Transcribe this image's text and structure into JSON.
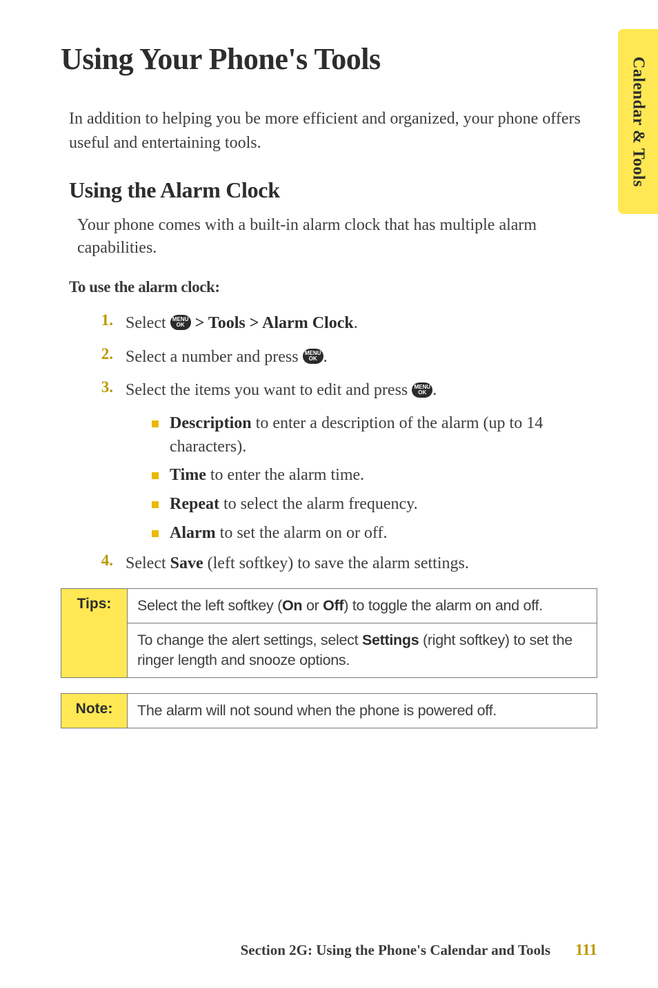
{
  "sideTab": {
    "label": "Calendar & Tools"
  },
  "h1": "Using Your Phone's Tools",
  "intro": "In addition to helping you be more efficient and organized, your phone offers useful and entertaining tools.",
  "h2": "Using the Alarm Clock",
  "body1": "Your phone comes with a built-in alarm clock that has multiple alarm capabilities.",
  "subhead": "To use the alarm clock:",
  "icon": {
    "label": "MENU\nOK"
  },
  "steps": {
    "s1": {
      "num": "1.",
      "pre": "Select ",
      "post": " > Tools > Alarm Clock",
      "tail": "."
    },
    "s2": {
      "num": "2.",
      "pre": "Select a number and press ",
      "tail": "."
    },
    "s3": {
      "num": "3.",
      "pre": "Select the items you want to edit and press ",
      "tail": "."
    },
    "s4": {
      "num": "4.",
      "pre": "Select ",
      "bold": "Save",
      "post": " (left softkey) to save the alarm settings."
    }
  },
  "bullets": {
    "b1": {
      "bold": "Description",
      "rest": " to enter a description of the alarm (up to 14 characters)."
    },
    "b2": {
      "bold": "Time",
      "rest": " to enter the alarm time."
    },
    "b3": {
      "bold": "Repeat",
      "rest": " to select the alarm frequency."
    },
    "b4": {
      "bold": "Alarm",
      "rest": " to set the alarm on or off."
    }
  },
  "tips": {
    "label": "Tips:",
    "row1": {
      "pre": "Select the left softkey (",
      "b1": "On",
      "mid": " or ",
      "b2": "Off",
      "post": ") to toggle the alarm on and off."
    },
    "row2": {
      "pre": "To change the alert settings, select ",
      "b": "Settings",
      "post": " (right softkey) to set the ringer length and snooze options."
    }
  },
  "note": {
    "label": "Note:",
    "text": "The alarm will not sound when the phone is powered off."
  },
  "footer": {
    "section": "Section 2G: Using the Phone's Calendar and Tools",
    "page": "111"
  }
}
